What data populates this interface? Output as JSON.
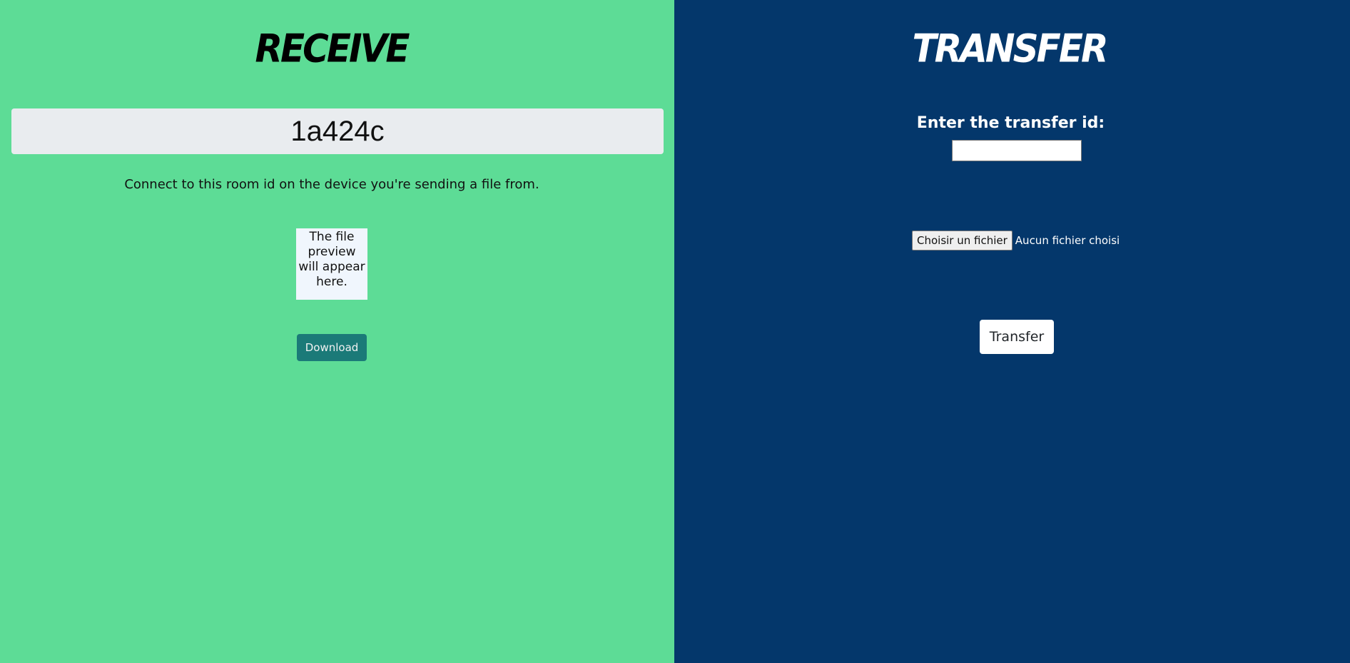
{
  "receive": {
    "title": "RECEIVE",
    "room_id": "1a424c",
    "hint": "Connect to this room id on the device you're sending a file from.",
    "preview_text": "The file preview will appear here.",
    "download_label": "Download",
    "background_color": "#5ddc96",
    "download_color": "#1b7a78"
  },
  "transfer": {
    "title": "TRANSFER",
    "id_label": "Enter the transfer id:",
    "id_value": "",
    "file_button_label": "Choisir un fichier",
    "file_status": "Aucun fichier choisi",
    "transfer_label": "Transfer",
    "background_color": "#04376b"
  }
}
